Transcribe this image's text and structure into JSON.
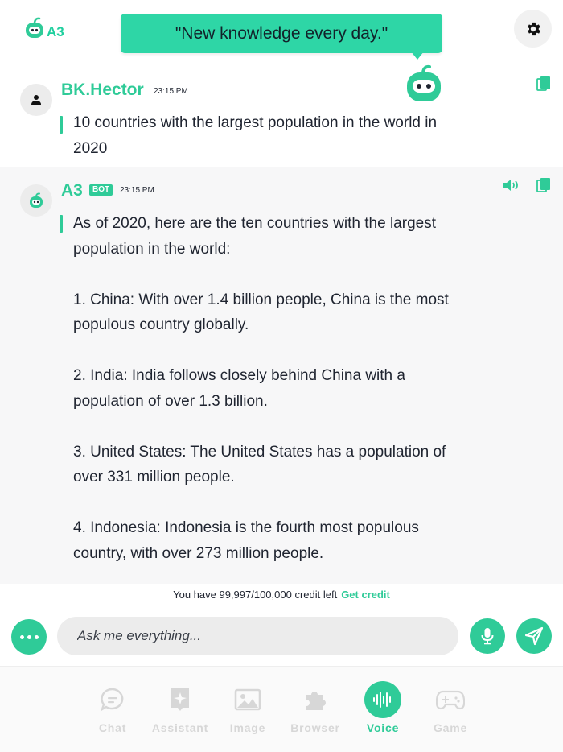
{
  "app": {
    "logo_text": "A3"
  },
  "header": {
    "tagline": "\"New knowledge every day.\""
  },
  "messages": {
    "user": {
      "sender": "BK.Hector",
      "time": "23:15 PM",
      "text": "10 countries with the largest population in the world in\n2020"
    },
    "bot": {
      "sender": "A3",
      "badge": "BOT",
      "time": "23:15 PM",
      "text": "As of 2020, here are the ten countries with the largest\npopulation in the world:\n\n1. China: With over 1.4 billion people, China is the most\npopulous country globally.\n\n2. India: India follows closely behind China with a\npopulation of over 1.3 billion.\n\n3. United States: The United States has a population of\nover 331 million people.\n\n4. Indonesia: Indonesia is the fourth most populous\ncountry, with over 273 million people."
    }
  },
  "credit": {
    "text": "You have 99,997/100,000 credit left",
    "link": "Get credit"
  },
  "composer": {
    "placeholder": "Ask me everything..."
  },
  "nav": {
    "items": [
      {
        "label": "Chat",
        "icon": "chat-icon"
      },
      {
        "label": "Assistant",
        "icon": "assistant-icon"
      },
      {
        "label": "Image",
        "icon": "image-icon"
      },
      {
        "label": "Browser",
        "icon": "puzzle-icon"
      },
      {
        "label": "Voice",
        "icon": "voice-wave-icon",
        "active": true
      },
      {
        "label": "Game",
        "icon": "gamepad-icon"
      }
    ]
  },
  "colors": {
    "accent": "#2fcb98",
    "tagline_bg": "#2ed6a6",
    "bot_bg": "#f7f7f8"
  }
}
